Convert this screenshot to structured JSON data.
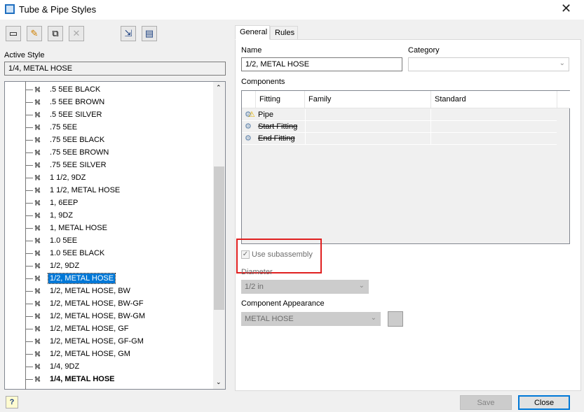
{
  "window": {
    "title": "Tube & Pipe Styles",
    "close_icon": "close-icon"
  },
  "toolbar": {
    "items": [
      "new-style-icon",
      "edit-pencil-icon",
      "copy-style-icon",
      "delete-icon",
      "import-icon",
      "save-export-icon"
    ]
  },
  "active_style": {
    "label": "Active Style",
    "value": "1/4, METAL HOSE"
  },
  "tree": {
    "items": [
      {
        "label": ".5 5EE BLACK"
      },
      {
        "label": ".5 5EE BROWN"
      },
      {
        "label": ".5 5EE SILVER"
      },
      {
        "label": ".75 5EE"
      },
      {
        "label": ".75 5EE BLACK"
      },
      {
        "label": ".75 5EE BROWN"
      },
      {
        "label": ".75 5EE SILVER"
      },
      {
        "label": "1 1/2, 9DZ"
      },
      {
        "label": "1 1/2, METAL HOSE"
      },
      {
        "label": "1, 6EEP"
      },
      {
        "label": "1, 9DZ"
      },
      {
        "label": "1, METAL HOSE"
      },
      {
        "label": "1.0 5EE"
      },
      {
        "label": "1.0 5EE BLACK"
      },
      {
        "label": "1/2, 9DZ"
      },
      {
        "label": "1/2, METAL HOSE",
        "selected": true
      },
      {
        "label": "1/2, METAL HOSE, BW"
      },
      {
        "label": "1/2, METAL HOSE, BW-GF"
      },
      {
        "label": "1/2, METAL HOSE, BW-GM"
      },
      {
        "label": "1/2, METAL HOSE, GF"
      },
      {
        "label": "1/2, METAL HOSE, GF-GM"
      },
      {
        "label": "1/2, METAL HOSE, GM"
      },
      {
        "label": "1/4, 9DZ"
      },
      {
        "label": "1/4, METAL HOSE",
        "active": true
      }
    ]
  },
  "tabs": [
    {
      "label": "General",
      "active": true
    },
    {
      "label": "Rules"
    }
  ],
  "general": {
    "name_label": "Name",
    "name_value": "1/2, METAL HOSE",
    "category_label": "Category",
    "category_value": "",
    "components_label": "Components",
    "columns": [
      "Fitting",
      "Family",
      "Standard"
    ],
    "rows": [
      {
        "fitting": "Pipe",
        "family": "",
        "standard": "",
        "warning": true,
        "disabled": false
      },
      {
        "fitting": "Start Fitting",
        "family": "",
        "standard": "",
        "disabled": true
      },
      {
        "fitting": "End Fitting",
        "family": "",
        "standard": "",
        "disabled": true
      }
    ],
    "use_subassembly_label": "Use subassembly",
    "use_subassembly_checked": true,
    "diameter_label": "Diameter",
    "diameter_value": "1/2 in",
    "appearance_label": "Component Appearance",
    "appearance_value": "METAL HOSE",
    "highlight_color": "#e02020"
  },
  "buttons": {
    "save": "Save",
    "close": "Close",
    "help_icon": "help-icon"
  }
}
